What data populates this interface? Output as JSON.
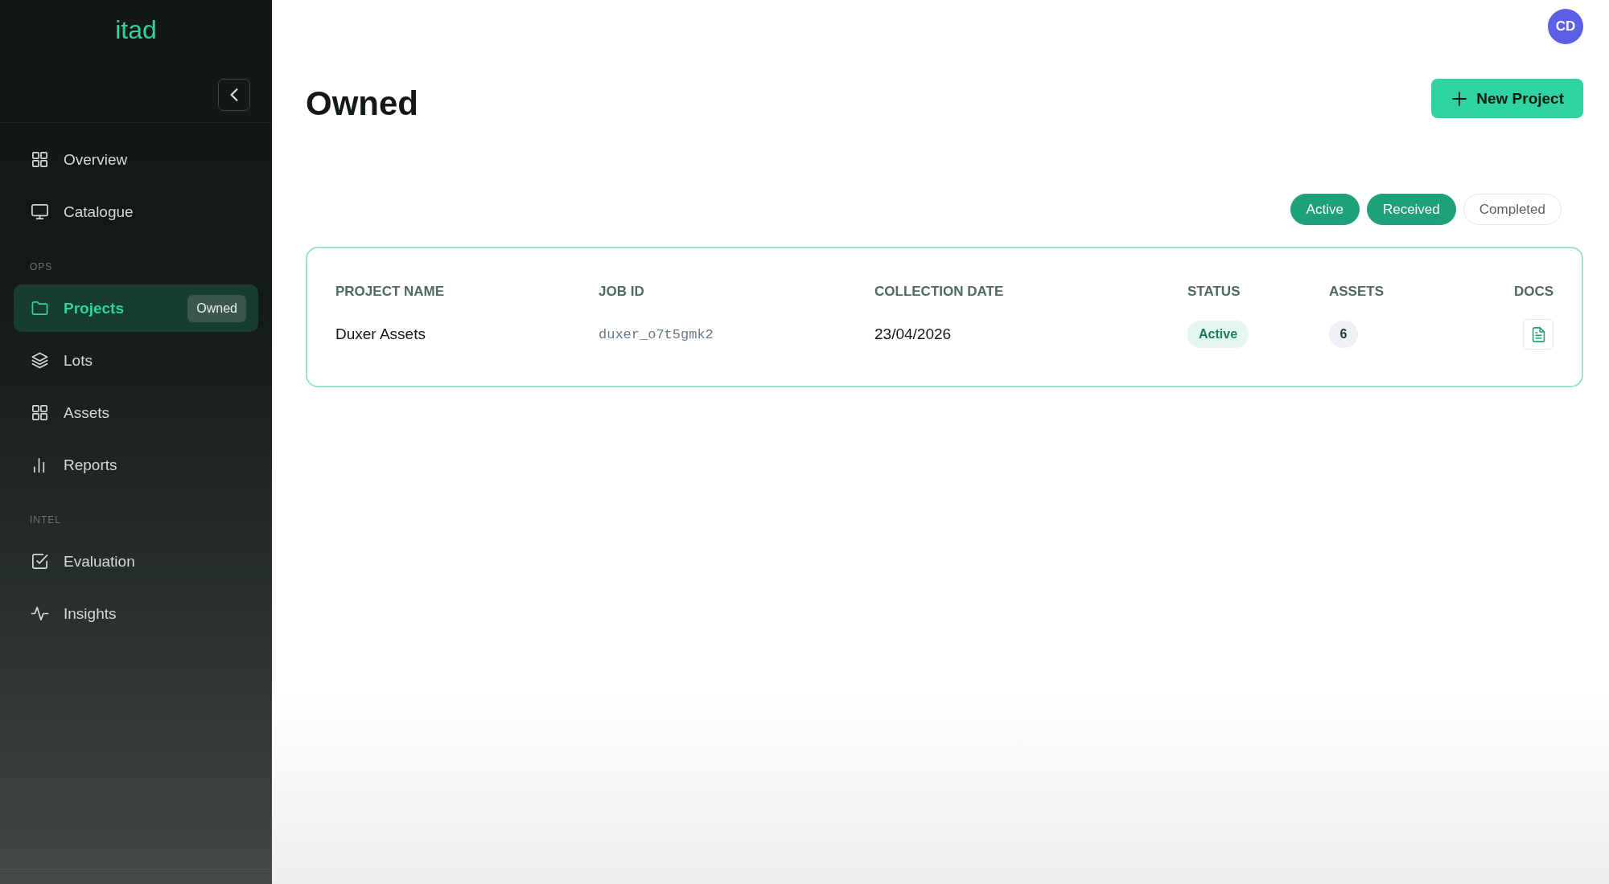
{
  "sidebar": {
    "logo": "itad",
    "sections": [
      {
        "items": [
          {
            "label": "Overview",
            "selected": false
          },
          {
            "label": "Catalogue",
            "selected": false
          }
        ]
      },
      {
        "title": "OPS",
        "items": [
          {
            "label": "Projects",
            "selected": true,
            "badge": "Owned"
          },
          {
            "label": "Lots",
            "selected": false
          },
          {
            "label": "Assets",
            "selected": false
          },
          {
            "label": "Reports",
            "selected": false
          }
        ]
      },
      {
        "title": "INTEL",
        "items": [
          {
            "label": "Evaluation",
            "selected": false
          },
          {
            "label": "Insights",
            "selected": false
          }
        ]
      }
    ]
  },
  "header": {
    "avatar": "CD",
    "title": "Owned",
    "new_button": "New Project"
  },
  "filters": [
    {
      "label": "Active",
      "selected": true
    },
    {
      "label": "Received",
      "selected": true
    },
    {
      "label": "Completed",
      "selected": false
    }
  ],
  "table": {
    "columns": [
      "PROJECT NAME",
      "JOB ID",
      "COLLECTION DATE",
      "STATUS",
      "ASSETS",
      "DOCS"
    ],
    "rows": [
      {
        "project_name": "Duxer Assets",
        "job_id": "duxer_o7t5gmk2",
        "collection_date": "23/04/2026",
        "status": "Active",
        "assets": "6"
      }
    ]
  }
}
